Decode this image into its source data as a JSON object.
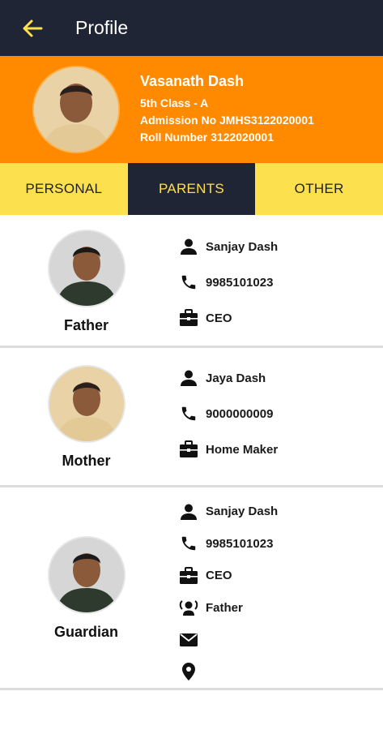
{
  "header": {
    "title": "Profile"
  },
  "student": {
    "name": "Vasanath Dash",
    "class": "5th Class - A",
    "admission": "Admission No  JMHS3122020001",
    "roll": "Roll Number  3122020001"
  },
  "tabs": [
    {
      "label": "PERSONAL"
    },
    {
      "label": "PARENTS"
    },
    {
      "label": "OTHER"
    }
  ],
  "active_tab": "PARENTS",
  "father": {
    "role": "Father",
    "name": "Sanjay Dash",
    "phone": "9985101023",
    "occupation": "CEO"
  },
  "mother": {
    "role": "Mother",
    "name": "Jaya Dash",
    "phone": "9000000009",
    "occupation": "Home Maker"
  },
  "guardian": {
    "role": "Guardian",
    "name": "Sanjay Dash",
    "phone": "9985101023",
    "occupation": "CEO",
    "relation": "Father",
    "email": "",
    "address": ""
  },
  "colors": {
    "header": "#1f2535",
    "accent_orange": "#ff8a00",
    "tab_yellow": "#fde04e"
  }
}
